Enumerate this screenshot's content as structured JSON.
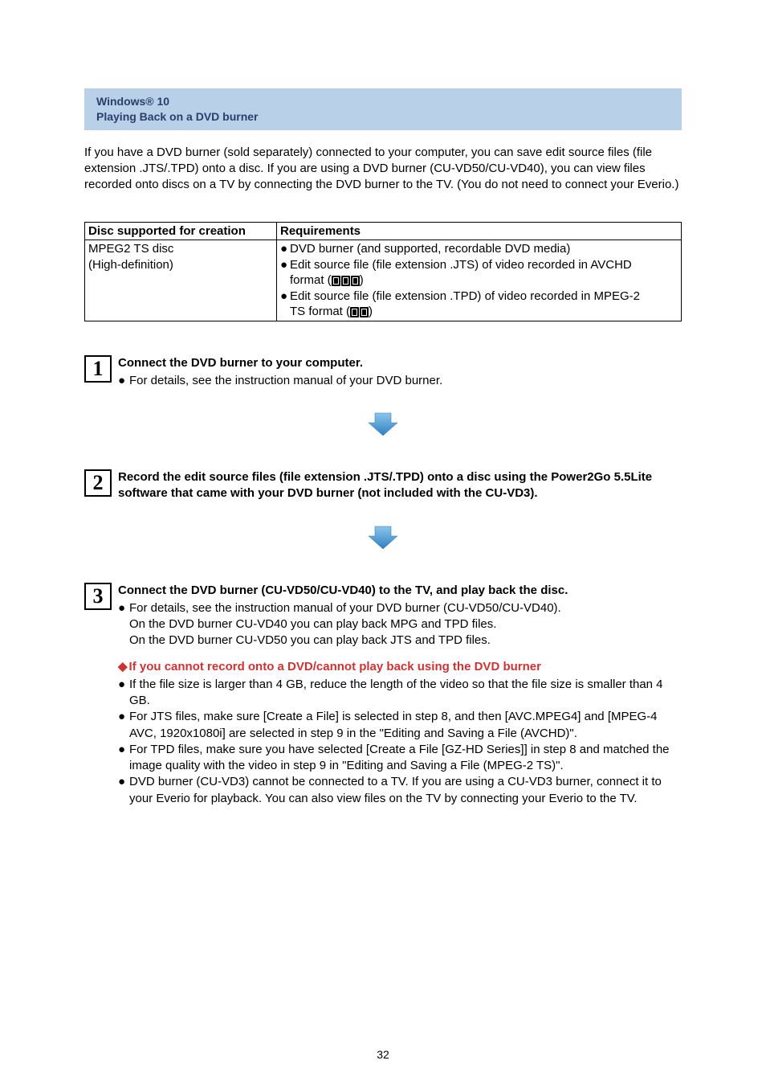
{
  "header": {
    "product": "Windows® 10",
    "title": "Playing Back on a DVD burner"
  },
  "intro": "If you have a DVD burner (sold separately) connected to your computer, you can save edit source files (file extension .JTS/.TPD) onto a disc. If you are using a DVD burner (CU-VD50/CU-VD40), you can view files recorded onto discs on a TV by connecting the DVD burner to the TV. (You do not need to connect your Everio.)",
  "table": {
    "col1": "Disc supported for creation",
    "col2": "Requirements",
    "row": {
      "disc_line1": "MPEG2 TS disc",
      "disc_line2": "(High-definition)",
      "req1": "DVD burner (and supported, recordable DVD media)",
      "req2a": "Edit source file (file extension .JTS) of video recorded in AVCHD",
      "req2b": "format (",
      "req2c": ")",
      "req3a": "Edit source file (file extension .TPD) of video recorded in MPEG-2",
      "req3b": "TS format (",
      "req3c": ")"
    }
  },
  "steps": {
    "s1": {
      "num": "1",
      "title": "Connect the DVD burner to your computer.",
      "text": "For details, see the instruction manual of your DVD burner."
    },
    "s2": {
      "num": "2",
      "title": "Record the edit source files (file extension .JTS/.TPD) onto a disc using the Power2Go 5.5Lite software that came with your DVD burner (not included with the CU-VD3)."
    },
    "s3": {
      "num": "3",
      "title": "Connect the DVD burner (CU-VD50/CU-VD40) to the TV, and play back the disc.",
      "text_line1": "For details, see the instruction manual of your DVD burner (CU-VD50/CU-VD40).",
      "text_line2": "On the DVD burner CU-VD40 you can play back MPG and TPD files.",
      "text_line3": "On the DVD burner CU-VD50 you can play back JTS and TPD files.",
      "cannot_header": "If you cannot record onto a DVD/cannot play back using the DVD burner",
      "b1": "If the file size is larger than 4 GB, reduce the length of the video so that the file size is smaller than 4 GB.",
      "b2": "For JTS files, make sure [Create a File] is selected in step 8, and then [AVC.MPEG4] and [MPEG-4 AVC, 1920x1080i] are selected in step 9 in the \"Editing and Saving a File (AVCHD)\".",
      "b3": "For TPD files, make sure you have selected [Create a File [GZ-HD Series]] in step 8 and matched the image quality with the video in step 9 in \"Editing and Saving a File (MPEG-2 TS)\".",
      "b4": "DVD burner (CU-VD3) cannot be connected to a TV. If you are using a CU-VD3 burner, connect it to your Everio for playback. You can also view files on the TV by connecting your Everio to the TV."
    }
  },
  "page_number": "32"
}
